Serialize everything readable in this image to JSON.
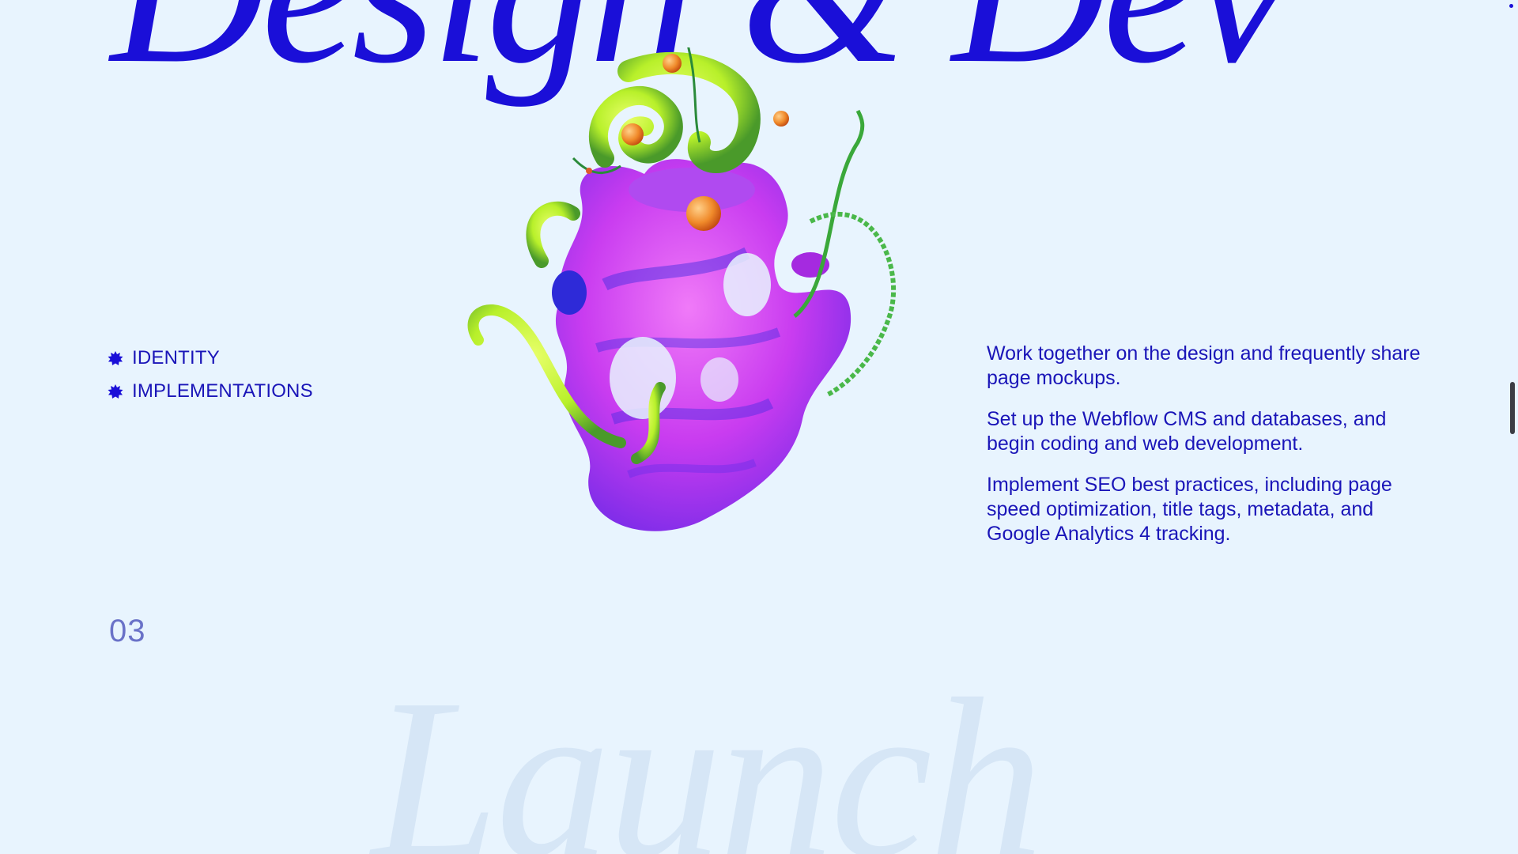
{
  "hero": {
    "title": "Design & Dev"
  },
  "tags": [
    {
      "label": "IDENTITY"
    },
    {
      "label": "IMPLEMENTATIONS"
    }
  ],
  "description": [
    "Work together on the design and frequently share page mockups.",
    "Set up the Webflow CMS and databases, and begin coding and web development.",
    "Implement SEO best practices, including page speed optimization, title tags, metadata, and Google Analytics 4 tracking."
  ],
  "next_step": {
    "number": "03",
    "title": "Launch"
  },
  "colors": {
    "background": "#e8f4fe",
    "accent": "#1a0fd8",
    "text": "#1a15b8",
    "muted_number": "#6a72c8",
    "ghost_text": "#d6e6f6",
    "sculpture_magenta": "#c93cf0",
    "sculpture_lime": "#b8f02a",
    "sculpture_orange": "#f08a2a"
  },
  "icons": {
    "tag_bullet": "starburst-bullet-icon",
    "sculpture": "abstract-3d-sculpture-image"
  }
}
